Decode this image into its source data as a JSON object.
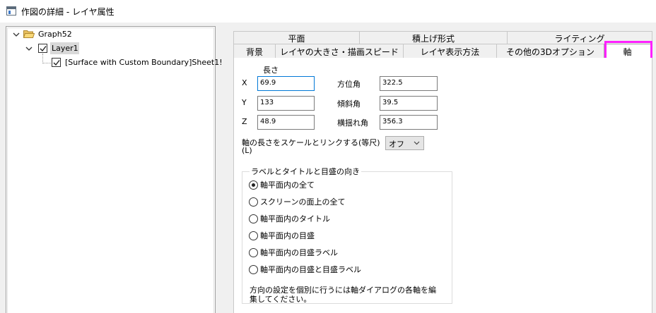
{
  "window": {
    "title": "作図の詳細 - レイヤ属性"
  },
  "tree": {
    "graph": "Graph52",
    "layer": "Layer1",
    "plot": "[Surface with Custom Boundary]Sheet1!"
  },
  "tabs": {
    "row1": [
      "平面",
      "積上げ形式",
      "ライティング"
    ],
    "row2": [
      "背景",
      "レイヤの大きさ・描画スピード",
      "レイヤ表示方法",
      "その他の3Dオプション",
      "軸"
    ],
    "active": "軸"
  },
  "axis_tab": {
    "length_header": "長さ",
    "x_label": "X",
    "x_value": "69.9",
    "y_label": "Y",
    "y_value": "133",
    "z_label": "Z",
    "z_value": "48.9",
    "azimuth_label": "方位角",
    "azimuth_value": "322.5",
    "tilt_label": "傾斜角",
    "tilt_value": "39.5",
    "roll_label": "横揺れ角",
    "roll_value": "356.3",
    "link_label_line1": "軸の長さをスケールとリンクする(等尺)",
    "link_label_line2": "(L)",
    "link_value": "オフ",
    "orientation_group_title": "ラベルとタイトルと目盛の向き",
    "orientation_options": [
      "軸平面内の全て",
      "スクリーンの面上の全て",
      "軸平面内のタイトル",
      "軸平面内の目盛",
      "軸平面内の目盛ラベル",
      "軸平面内の目盛と目盛ラベル"
    ],
    "orientation_selected_index": 0,
    "note_line1": "方向の設定を個別に行うには軸ダイアログの各軸を編",
    "note_line2": "集してください。"
  }
}
